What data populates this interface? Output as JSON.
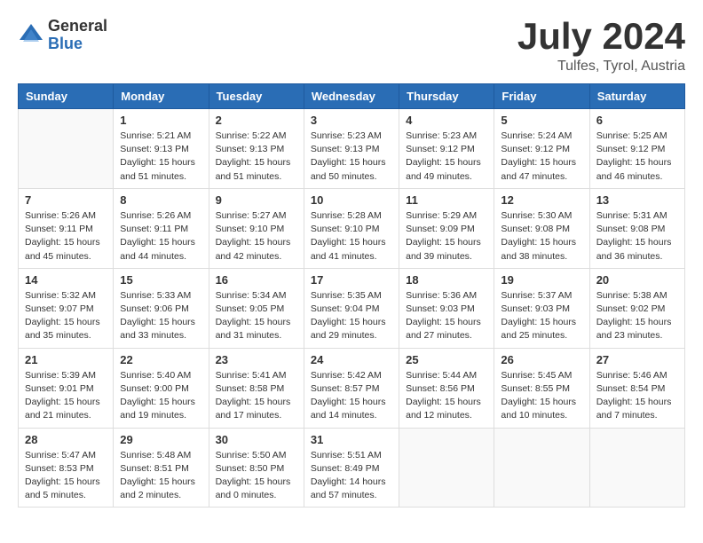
{
  "header": {
    "logo_general": "General",
    "logo_blue": "Blue",
    "title": "July 2024",
    "subtitle": "Tulfes, Tyrol, Austria"
  },
  "weekdays": [
    "Sunday",
    "Monday",
    "Tuesday",
    "Wednesday",
    "Thursday",
    "Friday",
    "Saturday"
  ],
  "weeks": [
    [
      {
        "day": "",
        "info": ""
      },
      {
        "day": "1",
        "info": "Sunrise: 5:21 AM\nSunset: 9:13 PM\nDaylight: 15 hours\nand 51 minutes."
      },
      {
        "day": "2",
        "info": "Sunrise: 5:22 AM\nSunset: 9:13 PM\nDaylight: 15 hours\nand 51 minutes."
      },
      {
        "day": "3",
        "info": "Sunrise: 5:23 AM\nSunset: 9:13 PM\nDaylight: 15 hours\nand 50 minutes."
      },
      {
        "day": "4",
        "info": "Sunrise: 5:23 AM\nSunset: 9:12 PM\nDaylight: 15 hours\nand 49 minutes."
      },
      {
        "day": "5",
        "info": "Sunrise: 5:24 AM\nSunset: 9:12 PM\nDaylight: 15 hours\nand 47 minutes."
      },
      {
        "day": "6",
        "info": "Sunrise: 5:25 AM\nSunset: 9:12 PM\nDaylight: 15 hours\nand 46 minutes."
      }
    ],
    [
      {
        "day": "7",
        "info": "Sunrise: 5:26 AM\nSunset: 9:11 PM\nDaylight: 15 hours\nand 45 minutes."
      },
      {
        "day": "8",
        "info": "Sunrise: 5:26 AM\nSunset: 9:11 PM\nDaylight: 15 hours\nand 44 minutes."
      },
      {
        "day": "9",
        "info": "Sunrise: 5:27 AM\nSunset: 9:10 PM\nDaylight: 15 hours\nand 42 minutes."
      },
      {
        "day": "10",
        "info": "Sunrise: 5:28 AM\nSunset: 9:10 PM\nDaylight: 15 hours\nand 41 minutes."
      },
      {
        "day": "11",
        "info": "Sunrise: 5:29 AM\nSunset: 9:09 PM\nDaylight: 15 hours\nand 39 minutes."
      },
      {
        "day": "12",
        "info": "Sunrise: 5:30 AM\nSunset: 9:08 PM\nDaylight: 15 hours\nand 38 minutes."
      },
      {
        "day": "13",
        "info": "Sunrise: 5:31 AM\nSunset: 9:08 PM\nDaylight: 15 hours\nand 36 minutes."
      }
    ],
    [
      {
        "day": "14",
        "info": "Sunrise: 5:32 AM\nSunset: 9:07 PM\nDaylight: 15 hours\nand 35 minutes."
      },
      {
        "day": "15",
        "info": "Sunrise: 5:33 AM\nSunset: 9:06 PM\nDaylight: 15 hours\nand 33 minutes."
      },
      {
        "day": "16",
        "info": "Sunrise: 5:34 AM\nSunset: 9:05 PM\nDaylight: 15 hours\nand 31 minutes."
      },
      {
        "day": "17",
        "info": "Sunrise: 5:35 AM\nSunset: 9:04 PM\nDaylight: 15 hours\nand 29 minutes."
      },
      {
        "day": "18",
        "info": "Sunrise: 5:36 AM\nSunset: 9:03 PM\nDaylight: 15 hours\nand 27 minutes."
      },
      {
        "day": "19",
        "info": "Sunrise: 5:37 AM\nSunset: 9:03 PM\nDaylight: 15 hours\nand 25 minutes."
      },
      {
        "day": "20",
        "info": "Sunrise: 5:38 AM\nSunset: 9:02 PM\nDaylight: 15 hours\nand 23 minutes."
      }
    ],
    [
      {
        "day": "21",
        "info": "Sunrise: 5:39 AM\nSunset: 9:01 PM\nDaylight: 15 hours\nand 21 minutes."
      },
      {
        "day": "22",
        "info": "Sunrise: 5:40 AM\nSunset: 9:00 PM\nDaylight: 15 hours\nand 19 minutes."
      },
      {
        "day": "23",
        "info": "Sunrise: 5:41 AM\nSunset: 8:58 PM\nDaylight: 15 hours\nand 17 minutes."
      },
      {
        "day": "24",
        "info": "Sunrise: 5:42 AM\nSunset: 8:57 PM\nDaylight: 15 hours\nand 14 minutes."
      },
      {
        "day": "25",
        "info": "Sunrise: 5:44 AM\nSunset: 8:56 PM\nDaylight: 15 hours\nand 12 minutes."
      },
      {
        "day": "26",
        "info": "Sunrise: 5:45 AM\nSunset: 8:55 PM\nDaylight: 15 hours\nand 10 minutes."
      },
      {
        "day": "27",
        "info": "Sunrise: 5:46 AM\nSunset: 8:54 PM\nDaylight: 15 hours\nand 7 minutes."
      }
    ],
    [
      {
        "day": "28",
        "info": "Sunrise: 5:47 AM\nSunset: 8:53 PM\nDaylight: 15 hours\nand 5 minutes."
      },
      {
        "day": "29",
        "info": "Sunrise: 5:48 AM\nSunset: 8:51 PM\nDaylight: 15 hours\nand 2 minutes."
      },
      {
        "day": "30",
        "info": "Sunrise: 5:50 AM\nSunset: 8:50 PM\nDaylight: 15 hours\nand 0 minutes."
      },
      {
        "day": "31",
        "info": "Sunrise: 5:51 AM\nSunset: 8:49 PM\nDaylight: 14 hours\nand 57 minutes."
      },
      {
        "day": "",
        "info": ""
      },
      {
        "day": "",
        "info": ""
      },
      {
        "day": "",
        "info": ""
      }
    ]
  ]
}
